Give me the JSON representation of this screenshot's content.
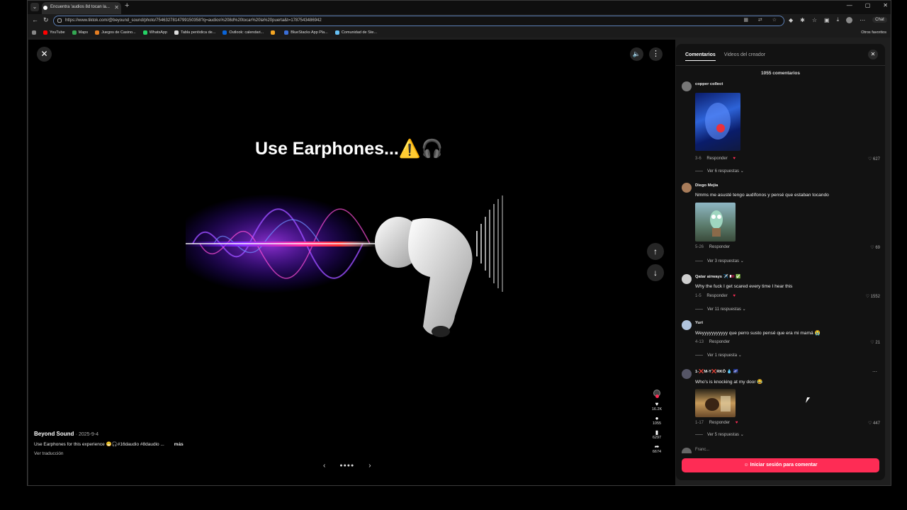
{
  "browser": {
    "tab_title": "Encuentra 'audios 8d tocan la...",
    "tab_close": "✕",
    "new_tab": "+",
    "window_buttons": [
      "—",
      "▢",
      "✕"
    ],
    "url": "https://www.tiktok.com/@beyound_sound/photo/7546327814799150358?q=audios%208d%20tocar%20la%20puerta&t=1787543486942",
    "chat_label": "Chat",
    "bookmarks": [
      {
        "label": "YouTube",
        "color": "#ff0000"
      },
      {
        "label": "Maps",
        "color": "#34a853"
      },
      {
        "label": "Juegos de Casino...",
        "color": "#e67e22"
      },
      {
        "label": "WhatsApp",
        "color": "#25d366"
      },
      {
        "label": "Tabla periódica de...",
        "color": "#dddddd"
      },
      {
        "label": "Outlook: calendari...",
        "color": "#0a64d8"
      },
      {
        "label": "",
        "color": "#f5a623"
      },
      {
        "label": "BlueStacks App Pla...",
        "color": "#3b6fd8"
      },
      {
        "label": "Comunidad de Ste...",
        "color": "#66c0f4"
      }
    ],
    "other_bookmarks": "Otros favoritos"
  },
  "viewer": {
    "headline": "Use Earphones...⚠️🎧",
    "author": "Beyond Sound",
    "date": "· 2025-9-4",
    "description": "Use Earphones for this experience 😁🎧#16daudio #8daudio ...",
    "more_label": "más",
    "translate_label": "Ver traducción",
    "pager_prev": "‹",
    "pager_next": "›",
    "pager_dots": "●●●●",
    "stats": {
      "likes": "16.2K",
      "comments": "1055",
      "saves": "6297",
      "shares": "6674"
    }
  },
  "panel": {
    "tab_comments": "Comentarios",
    "tab_videos": "Videos del creador",
    "count": "1055 comentarios",
    "partial_user": "Franc...",
    "login_button": "Iniciar sesión para comentar",
    "reply_label": "Responder",
    "comments": [
      {
        "user": "copper collect",
        "text": "",
        "date": "3-6",
        "likes": "627",
        "replies": "Ver 6 respuestas ⌄",
        "avatar_color": "#777777"
      },
      {
        "user": "Diego Mejia",
        "text": "Nmms me asusté tengo audífonos y pensé que estaban tocando",
        "date": "5-26",
        "likes": "69",
        "replies": "Ver 3 respuestas ⌄",
        "avatar_color": "#a87c5a"
      },
      {
        "user": "Qatar airways ✈️ 🇶🇦 ✅",
        "text": "Why the fuck I get scared every time I hear this",
        "date": "1-5",
        "likes": "1552",
        "replies": "Ver 11 respuestas ⌄",
        "avatar_color": "#cfcfcf"
      },
      {
        "user": "Yuri",
        "text": "Weyyyyyyyyyyy que perro susto pensé que era mi mamá 😭",
        "date": "4-13",
        "likes": "21",
        "replies": "Ver 1 respuesta ⌄",
        "avatar_color": "#b0c4de"
      },
      {
        "user": "1-❌M-Y❌RKŌ 💧 🌌",
        "text": "Who's is knocking at my door 😂",
        "date": "1-17",
        "likes": "447",
        "replies": "Ver 5 respuestas ⌄",
        "avatar_color": "#555566"
      }
    ]
  }
}
